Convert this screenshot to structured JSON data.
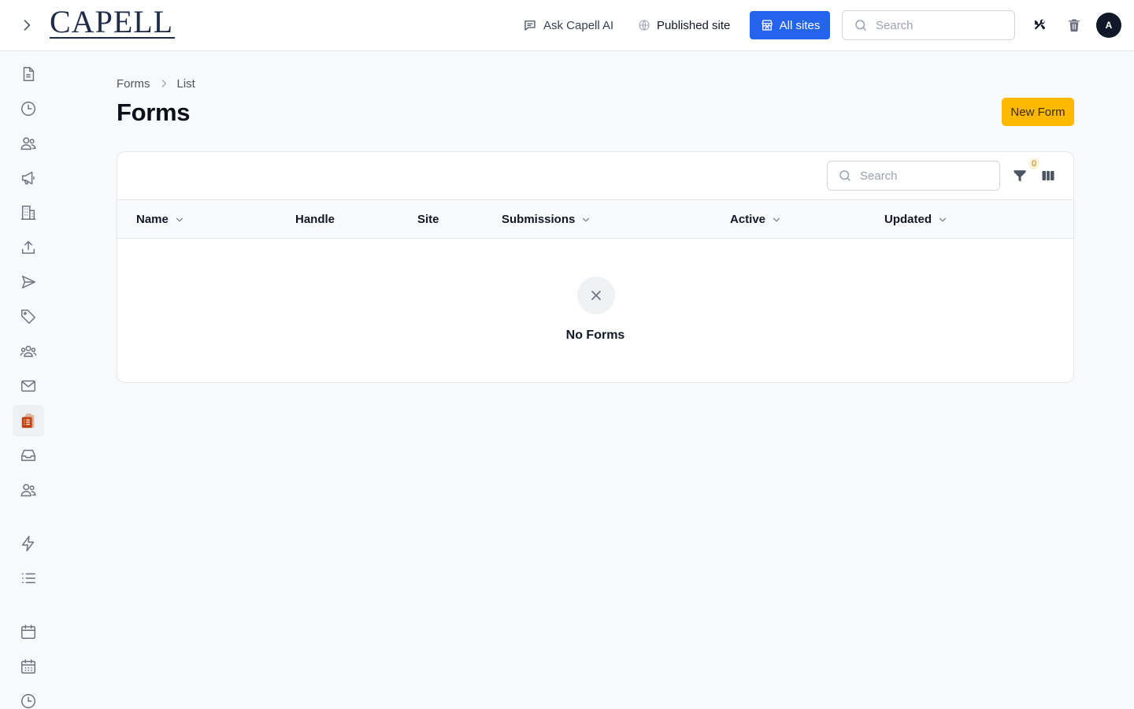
{
  "app": {
    "logo_text": "CAPELL",
    "ask_ai_label": "Ask Capell AI",
    "published_label": "Published site",
    "all_sites_label": "All sites",
    "search_placeholder": "Search",
    "avatar_initial": "A",
    "accent_color": "#2463eb",
    "primary_button_color": "#fcb900"
  },
  "sidebar": {
    "items": [
      {
        "icon": "document-icon"
      },
      {
        "icon": "clock-icon"
      },
      {
        "icon": "users-icon"
      },
      {
        "icon": "megaphone-icon"
      },
      {
        "icon": "building-icon"
      },
      {
        "icon": "upload-icon"
      },
      {
        "icon": "send-icon"
      },
      {
        "icon": "tag-icon"
      },
      {
        "icon": "user-group-icon"
      },
      {
        "icon": "envelope-icon"
      },
      {
        "icon": "clipboard-icon",
        "active": true
      },
      {
        "icon": "inbox-icon"
      },
      {
        "icon": "users-icon"
      },
      {
        "icon": "bolt-icon"
      },
      {
        "icon": "list-icon"
      },
      {
        "icon": "calendar-icon"
      },
      {
        "icon": "calendar-days-icon"
      },
      {
        "icon": "clock-icon"
      }
    ]
  },
  "breadcrumb": {
    "items": [
      "Forms",
      "List"
    ]
  },
  "page": {
    "title": "Forms",
    "new_button_label": "New Form"
  },
  "table": {
    "search_placeholder": "Search",
    "filter_count": "0",
    "columns": [
      {
        "label": "Name",
        "sortable": true
      },
      {
        "label": "Handle",
        "sortable": false
      },
      {
        "label": "Site",
        "sortable": false
      },
      {
        "label": "Submissions",
        "sortable": true
      },
      {
        "label": "Active",
        "sortable": true
      },
      {
        "label": "Updated",
        "sortable": true
      }
    ],
    "rows": [],
    "empty_text": "No Forms"
  }
}
